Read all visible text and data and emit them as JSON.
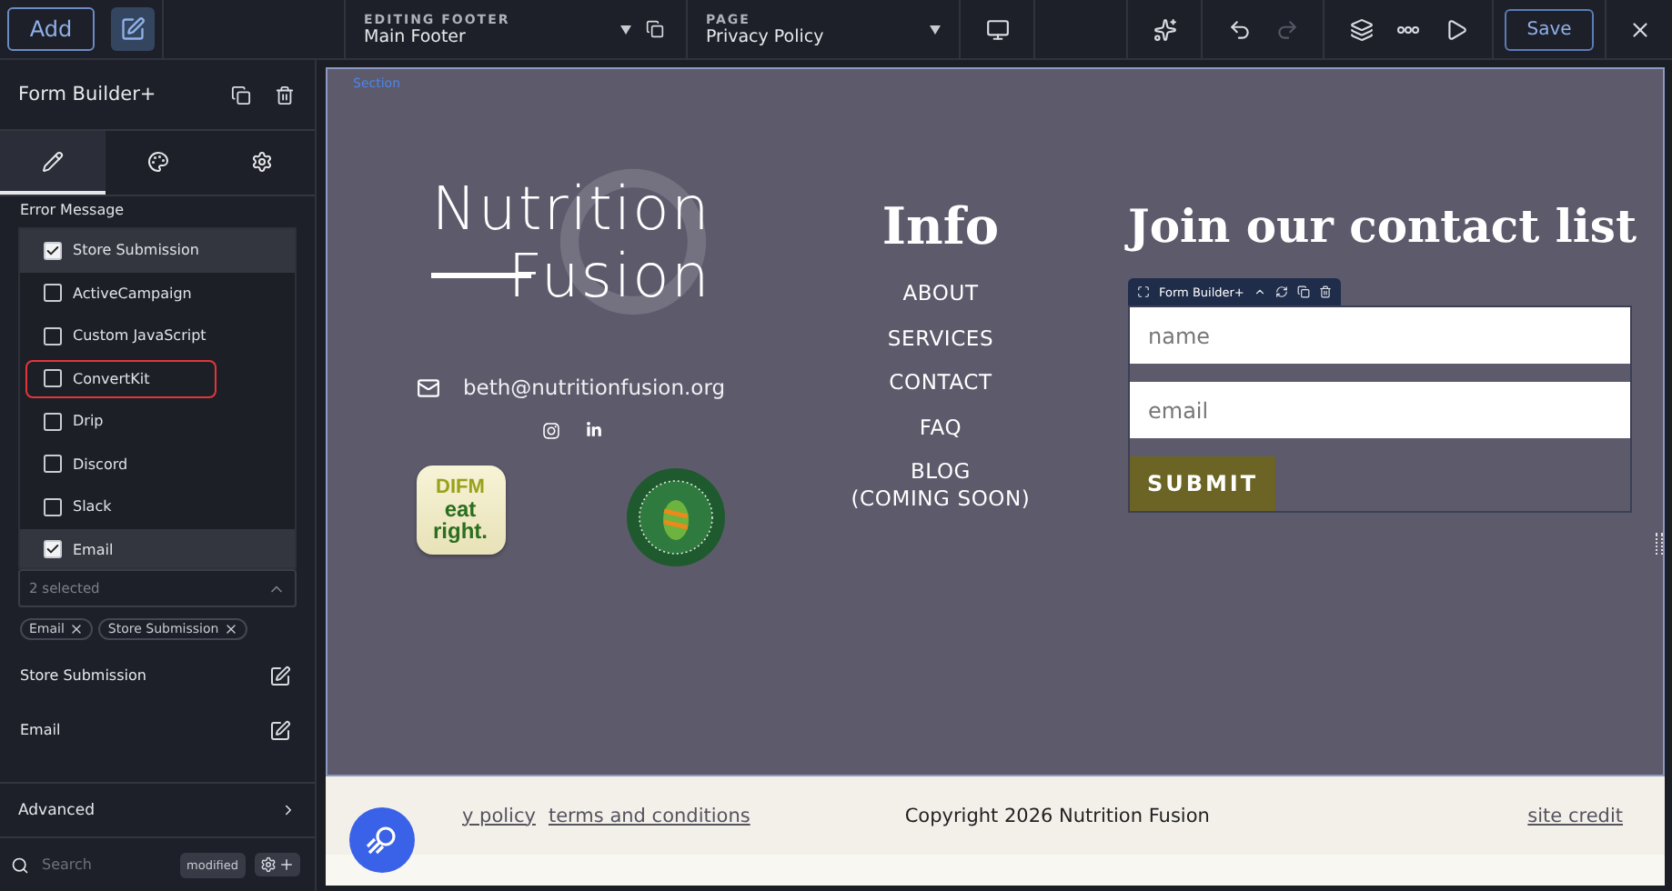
{
  "topbar": {
    "add_button": "Add",
    "editing": {
      "label": "EDITING FOOTER",
      "value": "Main Footer"
    },
    "page": {
      "label": "PAGE",
      "value": "Privacy Policy"
    },
    "redo_disabled": true,
    "save_button": "Save"
  },
  "panel": {
    "title": "Form Builder+",
    "tabs": [
      {
        "selected": true
      },
      {
        "selected": false
      },
      {
        "selected": false
      }
    ],
    "error_label": "Error Message",
    "options": [
      {
        "label": "Store Submission",
        "checked": true,
        "highlighted": false
      },
      {
        "label": "ActiveCampaign",
        "checked": false,
        "highlighted": false
      },
      {
        "label": "Custom JavaScript",
        "checked": false,
        "highlighted": false
      },
      {
        "label": "ConvertKit",
        "checked": false,
        "highlighted": true
      },
      {
        "label": "Drip",
        "checked": false,
        "highlighted": false
      },
      {
        "label": "Discord",
        "checked": false,
        "highlighted": false
      },
      {
        "label": "Slack",
        "checked": false,
        "highlighted": false
      },
      {
        "label": "Email",
        "checked": true,
        "highlighted": false
      }
    ],
    "select": {
      "value": "2 selected",
      "expanded": true
    },
    "chips": [
      "Email",
      "Store Submission"
    ],
    "actions": [
      "Store Submission",
      "Email"
    ],
    "advanced": "Advanced",
    "search": {
      "placeholder": "Search",
      "badge": "modified"
    }
  },
  "canvas": {
    "section_label": "Section",
    "logo": {
      "line1": "Nutrition",
      "line2": "Fusion"
    },
    "email": "beth@nutritionfusion.org",
    "badge": {
      "top": "DIFM",
      "middle": "eat",
      "bottom": "right."
    },
    "info": {
      "title": "Info",
      "links": [
        "ABOUT",
        "SERVICES",
        "CONTACT",
        "FAQ",
        "BLOG\n(COMING SOON)"
      ]
    },
    "form": {
      "title": "Join our contact list",
      "widget_label": "Form Builder+",
      "fields": [
        {
          "placeholder": "name"
        },
        {
          "placeholder": "email"
        }
      ],
      "submit": "SUBMIT"
    },
    "footer": {
      "links": [
        "y policy",
        "terms and conditions"
      ],
      "copyright": "Copyright 2026 Nutrition Fusion",
      "credit": "site credit"
    }
  }
}
